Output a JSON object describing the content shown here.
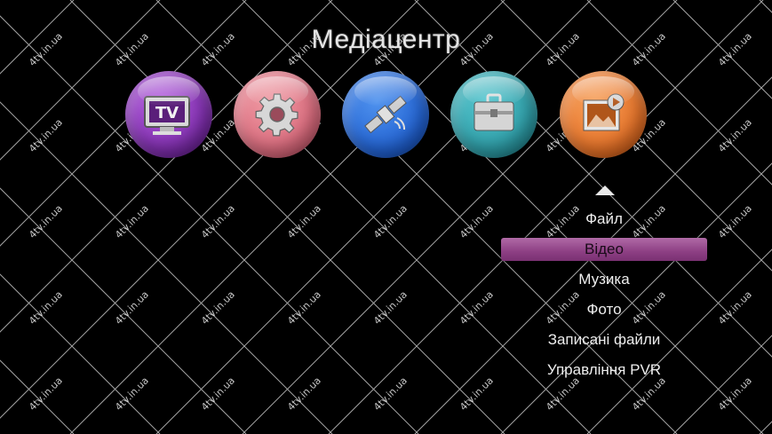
{
  "title": "Медіацентр",
  "watermark": "4tv.in.ua",
  "icons": [
    {
      "name": "tv-icon",
      "label": "TV"
    },
    {
      "name": "gear-icon"
    },
    {
      "name": "satellite-icon"
    },
    {
      "name": "toolbox-icon"
    },
    {
      "name": "media-icon"
    }
  ],
  "menu": {
    "items": [
      {
        "label": "Файл"
      },
      {
        "label": "Відео"
      },
      {
        "label": "Музика"
      },
      {
        "label": "Фото"
      },
      {
        "label": "Записані файли"
      },
      {
        "label": "Управління PVR"
      }
    ],
    "selected": "Відео"
  },
  "colors": {
    "background": "#000000",
    "selection": "#8d3f84",
    "tv_orb": "#7a2aa8",
    "settings_orb": "#d9677a",
    "satellite_orb": "#1f5fd0",
    "tools_orb": "#2a98a2",
    "media_orb": "#e36d23"
  }
}
